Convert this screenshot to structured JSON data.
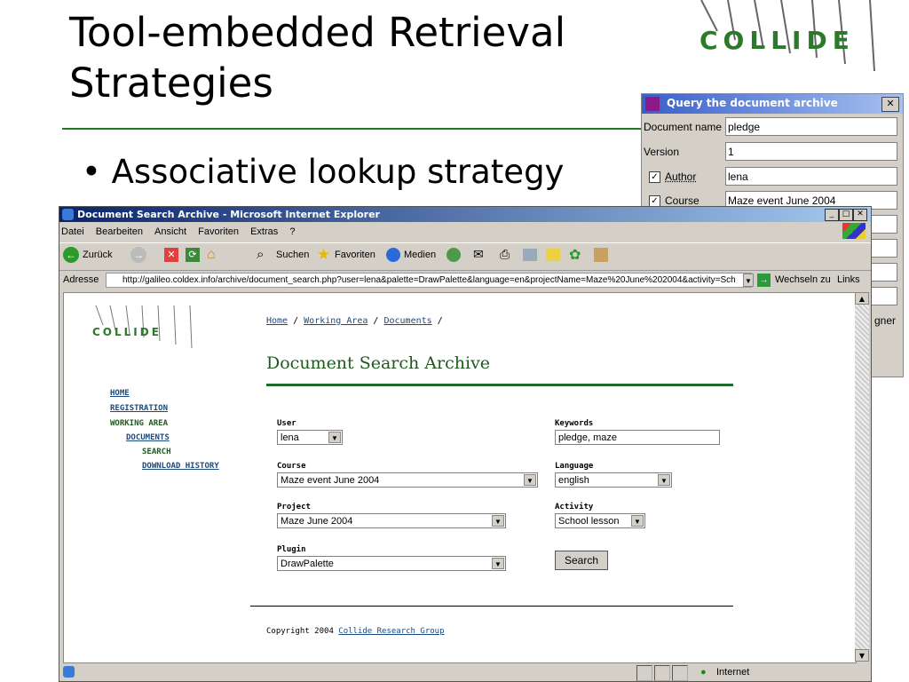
{
  "slide": {
    "title_line1": "Tool-embedded Retrieval",
    "title_line2": "Strategies",
    "bullet": "• Associative lookup strategy",
    "logo_text": "COLLIDE"
  },
  "query_dialog": {
    "title": "Query the document archive",
    "close": "✕",
    "rows": [
      {
        "label": "Document name",
        "value": "pledge",
        "checkbox": false
      },
      {
        "label": "Version",
        "value": "1",
        "checkbox": false
      },
      {
        "label": "Author",
        "value": "lena",
        "checkbox": true
      },
      {
        "label": "Course",
        "value": "Maze event June 2004",
        "checkbox": true
      }
    ],
    "partial_text": "gner"
  },
  "browser": {
    "title": "Document Search Archive - Microsoft Internet Explorer",
    "win_buttons": {
      "min": "_",
      "max": "□",
      "close": "✕"
    },
    "menu": [
      "Datei",
      "Bearbeiten",
      "Ansicht",
      "Favoriten",
      "Extras",
      "?"
    ],
    "toolbar": {
      "back": "Zurück",
      "search": "Suchen",
      "favorites": "Favoriten",
      "media": "Medien"
    },
    "address_label": "Adresse",
    "address": "http://galileo.coldex.info/archive/document_search.php?user=lena&palette=DrawPalette&language=en&projectName=Maze%20June%202004&activity=Sch",
    "go_label": "Wechseln zu",
    "links_label": "Links",
    "status": "Internet"
  },
  "page": {
    "nav": {
      "home": "HOME",
      "registration": "REGISTRATION",
      "working_area": "WORKING AREA",
      "documents": "DOCUMENTS",
      "search": "SEARCH",
      "download_history": "DOWNLOAD HISTORY"
    },
    "breadcrumb": {
      "home": "Home",
      "sep": " / ",
      "working_area": "Working Area",
      "documents": "Documents",
      "trail": " /"
    },
    "heading": "Document Search Archive",
    "form": {
      "user_label": "User",
      "user_value": "lena",
      "keywords_label": "Keywords",
      "keywords_value": "pledge, maze",
      "course_label": "Course",
      "course_value": "Maze event June 2004",
      "language_label": "Language",
      "language_value": "english",
      "project_label": "Project",
      "project_value": "Maze June 2004",
      "activity_label": "Activity",
      "activity_value": "School lesson",
      "plugin_label": "Plugin",
      "plugin_value": "DrawPalette",
      "search_button": "Search"
    },
    "copyright_prefix": "Copyright 2004 ",
    "copyright_link": "Collide Research Group"
  },
  "colors": {
    "title_rule": "#1e7b1e",
    "heading": "#1e5a1e",
    "link": "#1a4a80"
  }
}
